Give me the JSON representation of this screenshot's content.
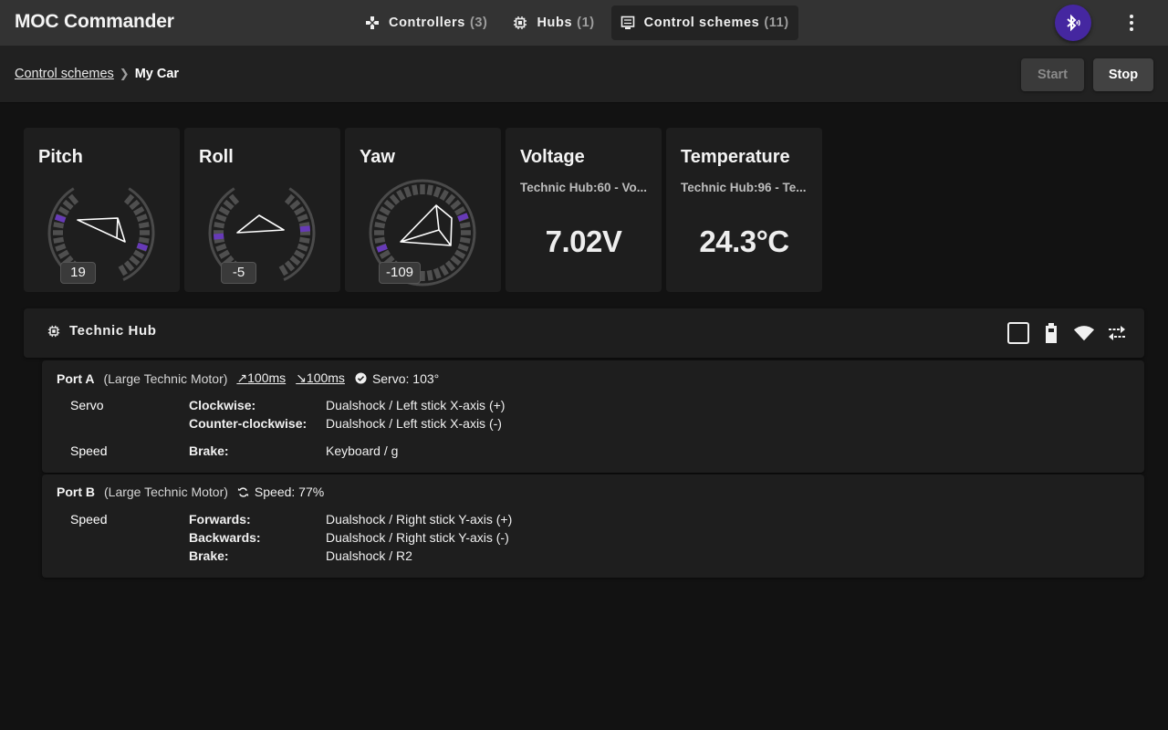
{
  "app": {
    "title": "MOC Commander"
  },
  "nav": {
    "items": [
      {
        "label": "Controllers",
        "count": "(3)",
        "icon": "gamepad-icon",
        "active": false
      },
      {
        "label": "Hubs",
        "count": "(1)",
        "icon": "chip-icon",
        "active": false
      },
      {
        "label": "Control schemes",
        "count": "(11)",
        "icon": "control-scheme-icon",
        "active": true
      }
    ],
    "bluetooth_icon": "bluetooth-searching-icon",
    "menu_icon": "more-vert-icon"
  },
  "breadcrumb": {
    "parent": "Control schemes",
    "separator": ">",
    "current": "My Car"
  },
  "actions": {
    "start_label": "Start",
    "stop_label": "Stop",
    "start_disabled": true
  },
  "widgets": [
    {
      "type": "gauge",
      "title": "Pitch",
      "value": "19"
    },
    {
      "type": "gauge",
      "title": "Roll",
      "value": "-5"
    },
    {
      "type": "gauge",
      "title": "Yaw",
      "value": "-109"
    },
    {
      "type": "sensor",
      "title": "Voltage",
      "source": "Technic Hub:60 - Vo...",
      "value": "7.02V"
    },
    {
      "type": "sensor",
      "title": "Temperature",
      "source": "Technic Hub:96 - Te...",
      "value": "24.3°C"
    }
  ],
  "hub": {
    "name": "Technic Hub",
    "icon": "chip-icon",
    "status_icons": [
      "checkbox-outline-icon",
      "battery-icon",
      "signal-icon",
      "swap-arrows-icon"
    ],
    "colors": {
      "accent": "#4527a0",
      "gauge_marker": "#673ab7"
    }
  },
  "ports": [
    {
      "name": "Port A",
      "type": "(Large Technic Motor)",
      "accel": "100ms",
      "decel": "100ms",
      "state_icon": "check-circle-icon",
      "state": "Servo: 103°",
      "bindings": [
        {
          "type": "Servo",
          "rows": [
            {
              "label": "Clockwise:",
              "value": "Dualshock / Left stick X-axis (+)"
            },
            {
              "label": "Counter-clockwise:",
              "value": "Dualshock / Left stick X-axis (-)"
            }
          ]
        },
        {
          "type": "Speed",
          "rows": [
            {
              "label": "Brake:",
              "value": "Keyboard / g"
            }
          ]
        }
      ]
    },
    {
      "name": "Port B",
      "type": "(Large Technic Motor)",
      "state_icon": "sync-icon",
      "state": "Speed: 77%",
      "bindings": [
        {
          "type": "Speed",
          "rows": [
            {
              "label": "Forwards:",
              "value": "Dualshock / Right stick Y-axis (+)"
            },
            {
              "label": "Backwards:",
              "value": "Dualshock / Right stick Y-axis (-)"
            },
            {
              "label": "Brake:",
              "value": "Dualshock / R2"
            }
          ]
        }
      ]
    }
  ]
}
